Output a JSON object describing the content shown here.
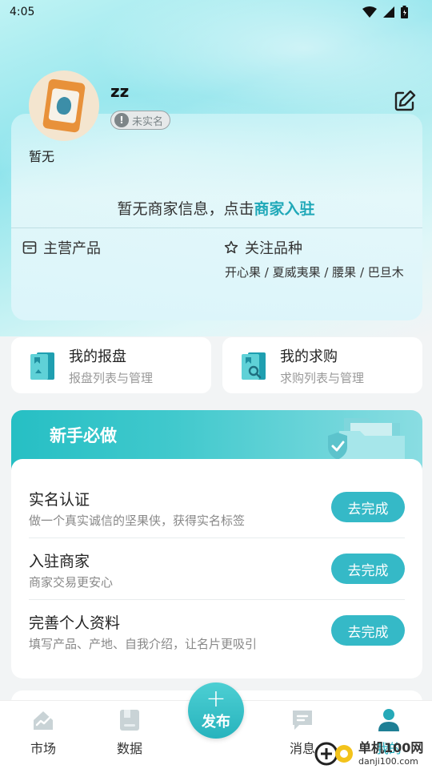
{
  "status": {
    "time": "4:05"
  },
  "profile": {
    "username": "zz",
    "realname_status": "未实名",
    "realname_icon": "!",
    "bio": "暂无"
  },
  "merchant": {
    "text": "暂无商家信息，点击",
    "link": "商家入驻"
  },
  "products": {
    "main_label": "主营产品",
    "follow_label": "关注品种",
    "follow_list": "开心果 / 夏威夷果 / 腰果 / 巴旦木"
  },
  "quick": [
    {
      "title": "我的报盘",
      "subtitle": "报盘列表与管理"
    },
    {
      "title": "我的求购",
      "subtitle": "求购列表与管理"
    }
  ],
  "newbie": {
    "title": "新手必做",
    "tasks": [
      {
        "title": "实名认证",
        "subtitle": "做一个真实诚信的坚果侠，获得实名标签",
        "button": "去完成"
      },
      {
        "title": "入驻商家",
        "subtitle": "商家交易更安心",
        "button": "去完成"
      },
      {
        "title": "完善个人资料",
        "subtitle": "填写产品、产地、自我介绍，让名片更吸引",
        "button": "去完成"
      }
    ]
  },
  "tabbar": {
    "items": [
      {
        "label": "市场"
      },
      {
        "label": "数据"
      },
      {
        "label": "消息"
      },
      {
        "label": "我的"
      }
    ],
    "publish_label": "发布",
    "publish_plus": "+"
  },
  "watermark": {
    "name": "单机100网",
    "url": "danji100.com"
  },
  "colors": {
    "accent": "#35b9c7",
    "link": "#1fa8b8"
  }
}
